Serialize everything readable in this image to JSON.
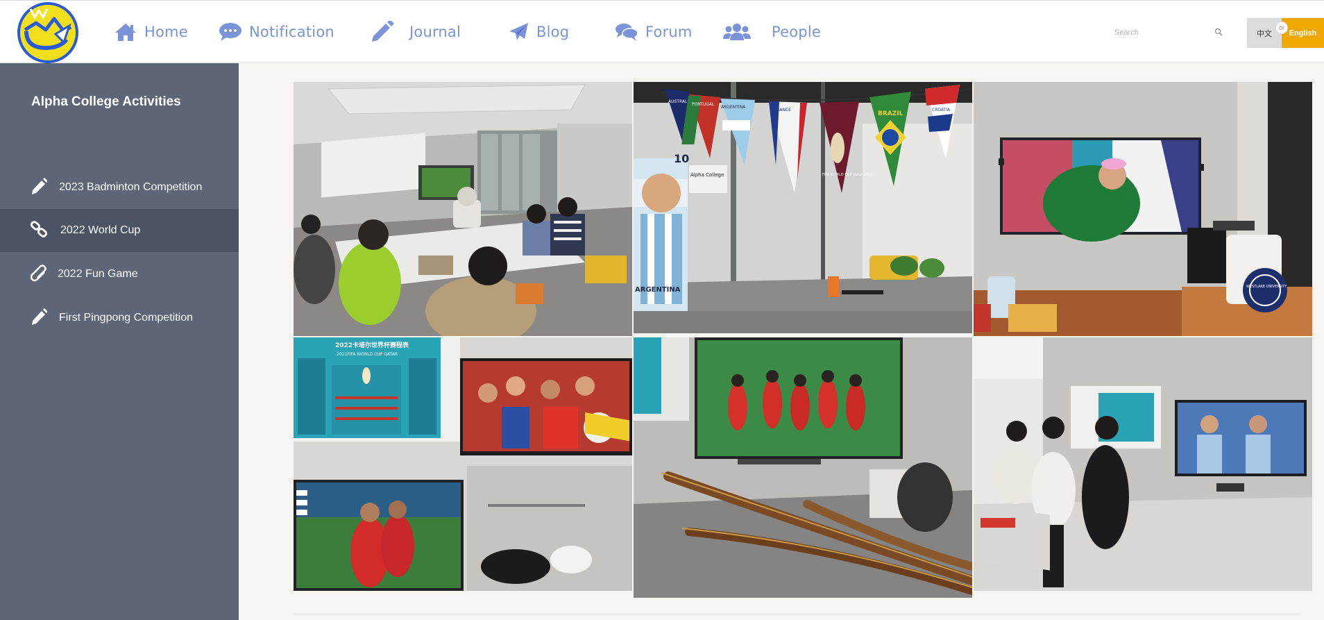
{
  "nav": {
    "items": [
      {
        "label": "Home",
        "icon": "home-icon"
      },
      {
        "label": "Notification",
        "icon": "comment-icon"
      },
      {
        "label": "Journal",
        "icon": "pencil-icon"
      },
      {
        "label": "Blog",
        "icon": "paper-plane-icon"
      },
      {
        "label": "Forum",
        "icon": "comments-icon"
      },
      {
        "label": "People",
        "icon": "users-icon"
      }
    ],
    "search_placeholder": "Search",
    "lang_zh": "中文",
    "lang_or": "or",
    "lang_en": "English"
  },
  "sidebar": {
    "title": "Alpha College Activities",
    "items": [
      {
        "label": "2023 Badminton Competition",
        "icon": "pencil-icon"
      },
      {
        "label": "2022 World Cup",
        "icon": "link-icon"
      },
      {
        "label": "2022 Fun Game",
        "icon": "paperclip-icon"
      },
      {
        "label": "First Pingpong Competition",
        "icon": "pencil-icon"
      }
    ]
  },
  "photos": {
    "flag_labels": [
      "AUSTRALIA",
      "PORTUGAL",
      "ARGENTINA",
      "FRANCE",
      "BRAZIL",
      "CROATIA"
    ],
    "banner_text": "Alpha College",
    "poster_name": "ARGENTINA",
    "poster_number": "10",
    "wallchart_title": "2022卡塔尔世界杯赛程表",
    "wallchart_subtitle": "2022FIFA WORLD CUP QATAR",
    "badge_text": "WESTLAKE UNIVERSITY",
    "wc_logo_text": "FIFA WORLD CUP Qatar 2022"
  },
  "colors": {
    "nav_text": "#7a93d9",
    "sidebar_bg": "#5c6676",
    "sidebar_active": "#4a5462",
    "lang_en_bg": "#f0a800",
    "logo_yellow": "#f2e01c",
    "logo_blue": "#2a5bd7"
  }
}
